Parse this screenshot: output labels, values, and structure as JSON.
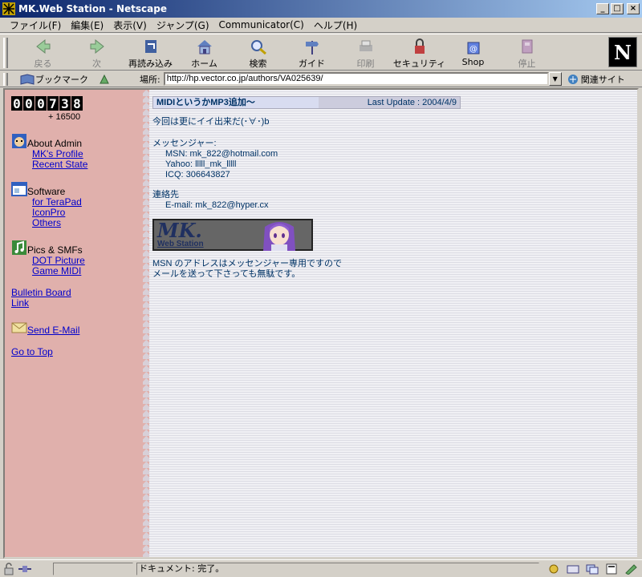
{
  "window": {
    "title": "MK.Web Station - Netscape",
    "minimize": "_",
    "maximize": "□",
    "close": "×"
  },
  "menu": [
    "ファイル(F)",
    "編集(E)",
    "表示(V)",
    "ジャンプ(G)",
    "Communicator(C)",
    "ヘルプ(H)"
  ],
  "toolbar": {
    "back": "戻る",
    "forward": "次",
    "reload": "再読み込み",
    "home": "ホーム",
    "search": "検索",
    "guide": "ガイド",
    "print": "印刷",
    "security": "セキュリティ",
    "shop": "Shop",
    "stop": "停止",
    "logo": "N"
  },
  "location": {
    "bookmark": "ブックマーク",
    "label": "場所:",
    "url": "http://hp.vector.co.jp/authors/VA025639/",
    "related": "関連サイト"
  },
  "sidebar": {
    "counter_digits": [
      "0",
      "0",
      "0",
      "7",
      "3",
      "8"
    ],
    "counter_sub": "+ 16500",
    "sections": [
      {
        "title": "About Admin",
        "links": [
          "MK's Profile",
          "Recent State"
        ]
      },
      {
        "title": "Software",
        "links": [
          "for TeraPad",
          "IconPro",
          "Others"
        ]
      },
      {
        "title": "Pics & SMFs",
        "links": [
          "DOT Picture",
          "Game MIDI"
        ]
      }
    ],
    "bulletin": "Bulletin Board",
    "link": "Link",
    "send_email": "Send E-Mail",
    "go_top": "Go to Top"
  },
  "content": {
    "head_title": "MIDIというかMP3追加～",
    "last_update": "Last Update : 2004/4/9",
    "intro": "今回は更にイイ出来だ(･∀･)b",
    "messenger_label": "メッセンジャー:",
    "msn": "MSN: mk_822@hotmail.com",
    "yahoo": "Yahoo: lllll_mk_lllll",
    "icq": "ICQ: 306643827",
    "contact_label": "連絡先",
    "email": "E-mail: mk_822@hyper.cx",
    "banner_title": "MK.",
    "banner_sub": "Web Station",
    "note_line1": "MSN のアドレスはメッセンジャー専用ですので",
    "note_line2": "メールを送って下さっても無駄です。"
  },
  "status": {
    "text": "ドキュメント: 完了。"
  }
}
